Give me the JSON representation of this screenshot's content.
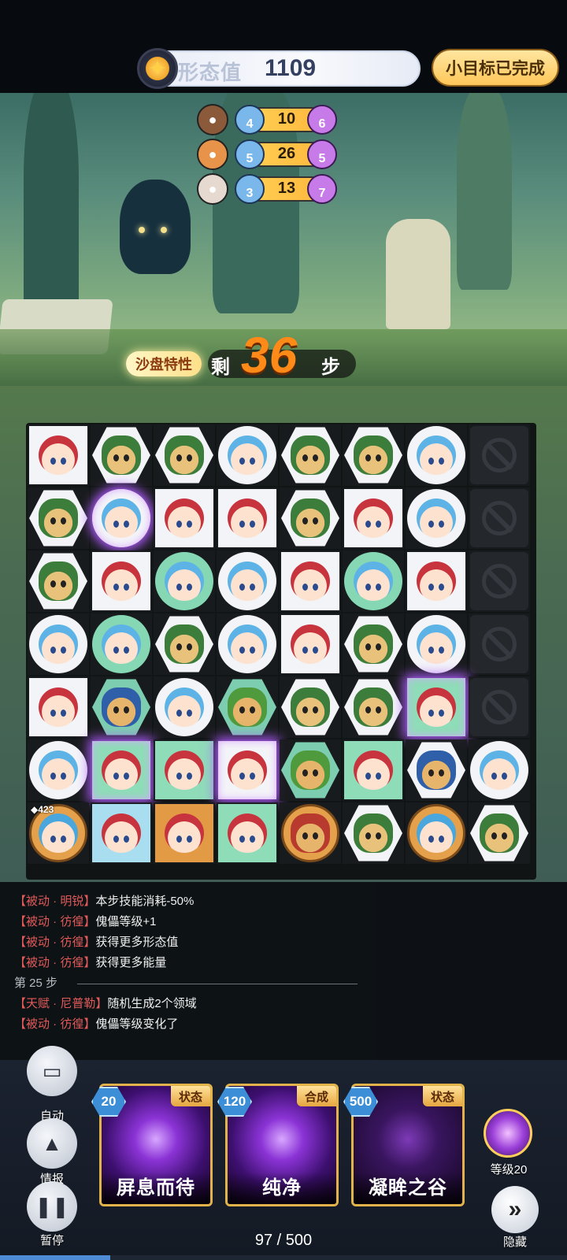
{
  "header": {
    "form_label": "形态值",
    "form_value": "1109",
    "goal_label": "小目标已完成"
  },
  "enemies": [
    {
      "left": "4",
      "mid": "10",
      "right": "6"
    },
    {
      "left": "5",
      "mid": "26",
      "right": "5"
    },
    {
      "left": "3",
      "mid": "13",
      "right": "7"
    }
  ],
  "steps": {
    "tag": "沙盘特性",
    "prefix": "剩",
    "count": "36",
    "unit": "步"
  },
  "board": {
    "badge": "423",
    "rows": [
      [
        "red-square",
        "wolf-hex",
        "wolf-hex",
        "blue-circle",
        "wolf-hex-glow",
        "wolf-hex",
        "blue-circle",
        "blocked"
      ],
      [
        "wolf-hex",
        "blue-circle-glow",
        "red-square",
        "red-square",
        "wolf-hex",
        "red-square",
        "blue-circle",
        "blocked"
      ],
      [
        "wolf-hex",
        "red-square",
        "blue-circle-green",
        "blue-circle",
        "red-square",
        "blue-circle-green",
        "red-square",
        "blocked"
      ],
      [
        "blue-circle",
        "blue-circle-green",
        "wolf-hex",
        "blue-circle",
        "red-square",
        "wolf-hex-glow",
        "blue-circle",
        "blocked"
      ],
      [
        "red-square",
        "boss-hex-green",
        "blue-circle",
        "bossgreen-hex-green",
        "wolf-hex",
        "wolf-hex",
        "red-square-green-glow",
        "blocked"
      ],
      [
        "blue-circle",
        "red-square-green-glow",
        "red-square-green",
        "red-square-glow",
        "bossgreen-hex-green",
        "red-square-green",
        "boss-hex-glow",
        "blue-circle"
      ],
      [
        "gold-circle",
        "red-square-blue",
        "red-square-gold",
        "red-square-green",
        "bossred-circle-gold",
        "wolf-hex",
        "gold-circle",
        "wolf-hex"
      ]
    ]
  },
  "log": {
    "lines": [
      {
        "tag": "【被动 · 明锐】",
        "text": "本步技能消耗-50%"
      },
      {
        "tag": "【被动 · 彷徨】",
        "text": "傀儡等级+1"
      },
      {
        "tag": "【被动 · 彷徨】",
        "text": "获得更多形态值"
      },
      {
        "tag": "【被动 · 彷徨】",
        "text": "获得更多能量"
      }
    ],
    "separator": "第 25 步",
    "lines2": [
      {
        "tag": "【天赋 · 尼普勒】",
        "text": "随机生成2个领域"
      },
      {
        "tag": "【被动 · 彷徨】",
        "text": "傀儡等级变化了"
      }
    ]
  },
  "controls": {
    "auto": "自动",
    "info": "情报",
    "pause": "暂停",
    "hide": "隐藏",
    "level": "等级20"
  },
  "cards": [
    {
      "cost": "20",
      "tag": "状态",
      "name": "屏息而待"
    },
    {
      "cost": "120",
      "tag": "合成",
      "name": "纯净"
    },
    {
      "cost": "500",
      "tag": "状态",
      "name": "凝眸之谷"
    }
  ],
  "energy": {
    "text": "97 / 500",
    "current": 97,
    "max": 500
  }
}
